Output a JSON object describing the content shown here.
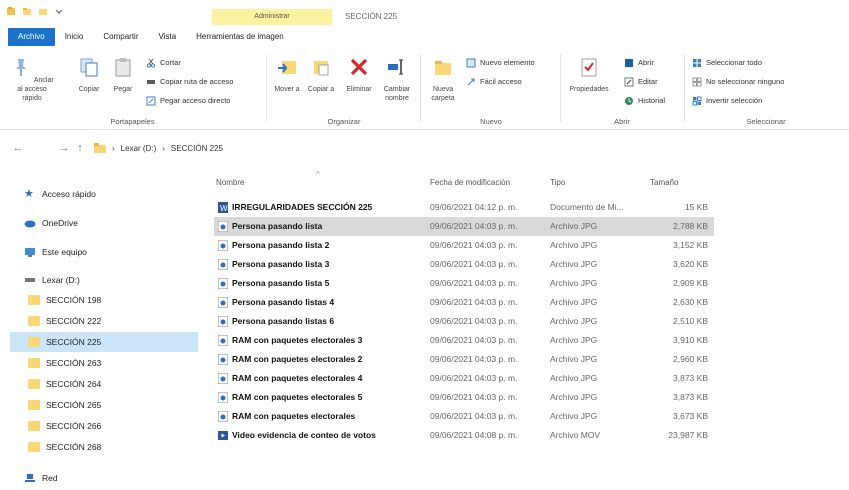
{
  "window": {
    "context_tab": "Administrar",
    "title": "SECCIÓN 225"
  },
  "tabs": [
    {
      "label": "Archivo"
    },
    {
      "label": "Inicio"
    },
    {
      "label": "Compartir"
    },
    {
      "label": "Vista"
    },
    {
      "label": "Herramientas de imagen"
    }
  ],
  "ribbon": {
    "portapapeles": {
      "label": "Portapapeles",
      "anclar": "Anclar al acceso rápido",
      "copiar": "Copiar",
      "pegar": "Pegar",
      "cortar": "Cortar",
      "copiar_ruta": "Copiar ruta de acceso",
      "pegar_acceso": "Pegar acceso directo"
    },
    "organizar": {
      "label": "Organizar",
      "mover": "Mover a",
      "copiar_a": "Copiar a",
      "eliminar": "Eliminar",
      "cambiar_nombre": "Cambiar nombre"
    },
    "nuevo": {
      "label": "Nuevo",
      "nueva_carpeta": "Nueva carpeta",
      "nuevo_elemento": "Nuevo elemento",
      "facil_acceso": "Fácil acceso"
    },
    "abrir": {
      "label": "Abrir",
      "propiedades": "Propiedades",
      "abrir": "Abrir",
      "editar": "Editar",
      "historial": "Historial"
    },
    "seleccionar": {
      "label": "Seleccionar",
      "todo": "Seleccionar todo",
      "ninguno": "No seleccionar ninguno",
      "invertir": "Invertir selección"
    }
  },
  "address": {
    "crumbs": [
      "Lexar (D:)",
      "SECCIÓN 225"
    ]
  },
  "nav": {
    "quick_access": "Acceso rápido",
    "onedrive": "OneDrive",
    "this_pc": "Este equipo",
    "drive": "Lexar (D:)",
    "folders": [
      "SECCIÓN 198",
      "SECCIÓN 222",
      "SECCIÓN 225",
      "SECCIÓN 263",
      "SECCIÓN 264",
      "SECCIÓN 265",
      "SECCIÓN 266",
      "SECCIÓN 268"
    ],
    "network": "Red"
  },
  "columns": {
    "name": "Nombre",
    "date": "Fecha de modificación",
    "type": "Tipo",
    "size": "Tamaño"
  },
  "files": [
    {
      "name": "IRREGULARIDADES SECCIÓN 225",
      "date": "09/06/2021 04:12 p. m.",
      "type": "Documento de Mi...",
      "size": "15 KB"
    },
    {
      "name": "Persona pasando lista",
      "date": "09/06/2021 04:03 p. m.",
      "type": "Archivo JPG",
      "size": "2,788 KB"
    },
    {
      "name": "Persona pasando lista 2",
      "date": "09/06/2021 04:03 p. m.",
      "type": "Archivo JPG",
      "size": "3,152 KB"
    },
    {
      "name": "Persona pasando lista 3",
      "date": "09/06/2021 04:03 p. m.",
      "type": "Archivo JPG",
      "size": "3,620 KB"
    },
    {
      "name": "Persona pasando lista 5",
      "date": "09/06/2021 04:03 p. m.",
      "type": "Archivo JPG",
      "size": "2,909 KB"
    },
    {
      "name": "Persona pasando listas 4",
      "date": "09/06/2021 04:03 p. m.",
      "type": "Archivo JPG",
      "size": "2,630 KB"
    },
    {
      "name": "Persona pasando listas 6",
      "date": "09/06/2021 04:03 p. m.",
      "type": "Archivo JPG",
      "size": "2,510 KB"
    },
    {
      "name": "RAM con paquetes electorales 3",
      "date": "09/06/2021 04:03 p. m.",
      "type": "Archivo JPG",
      "size": "3,910 KB"
    },
    {
      "name": "RAM con paquetes electorales 2",
      "date": "09/06/2021 04:03 p. m.",
      "type": "Archivo JPG",
      "size": "2,960 KB"
    },
    {
      "name": "RAM con paquetes electorales 4",
      "date": "09/06/2021 04:03 p. m.",
      "type": "Archivo JPG",
      "size": "3,873 KB"
    },
    {
      "name": "RAM con paquetes electorales 5",
      "date": "09/06/2021 04:03 p. m.",
      "type": "Archivo JPG",
      "size": "3,873 KB"
    },
    {
      "name": "RAM con paquetes electorales",
      "date": "09/06/2021 04:03 p. m.",
      "type": "Archivo JPG",
      "size": "3,673 KB"
    },
    {
      "name": "Video evidencia de conteo de votos",
      "date": "09/06/2021 04:08 p. m.",
      "type": "Archivo MOV",
      "size": "23,987 KB"
    }
  ],
  "colors": {
    "file_tab": "#1a73c8",
    "context_tab": "#fbf3a0",
    "folder": "#f8d774",
    "selection": "#cce4f7",
    "row_selected": "#d9d9d9"
  }
}
